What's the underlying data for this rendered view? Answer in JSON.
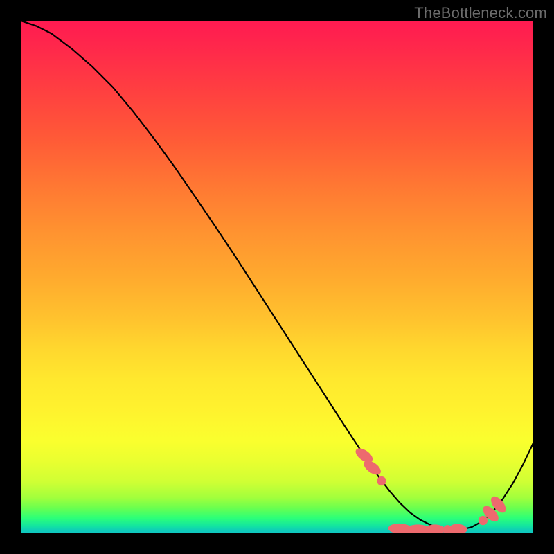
{
  "watermark": "TheBottleneck.com",
  "chart_data": {
    "type": "line",
    "title": "",
    "xlabel": "",
    "ylabel": "",
    "xlim": [
      0,
      100
    ],
    "ylim": [
      0,
      100
    ],
    "grid": false,
    "legend": false,
    "series": [
      {
        "name": "curve",
        "x": [
          0,
          3,
          6,
          10,
          14,
          18,
          22,
          26,
          30,
          34,
          38,
          42,
          46,
          50,
          54,
          58,
          62,
          65,
          68,
          70,
          72,
          74,
          76,
          78,
          80,
          82,
          84,
          86,
          88,
          90,
          92,
          94,
          96,
          98,
          100
        ],
        "y": [
          100,
          99,
          97.5,
          94.5,
          91,
          87,
          82.2,
          77,
          71.5,
          65.7,
          59.8,
          53.8,
          47.6,
          41.4,
          35.2,
          29,
          22.8,
          18.2,
          13.7,
          10.8,
          8.2,
          5.9,
          4.0,
          2.6,
          1.6,
          1.0,
          0.7,
          0.7,
          1.2,
          2.3,
          4.1,
          6.6,
          9.7,
          13.4,
          17.6
        ]
      }
    ],
    "markers": [
      {
        "name": "marker-lozenge",
        "cx": 67.0,
        "cy": 15.2,
        "rx": 1.0,
        "ry": 1.9,
        "rot": -55
      },
      {
        "name": "marker-lozenge",
        "cx": 68.6,
        "cy": 12.8,
        "rx": 1.0,
        "ry": 1.9,
        "rot": -55
      },
      {
        "name": "marker-dot",
        "cx": 70.4,
        "cy": 10.2,
        "rx": 0.9,
        "ry": 0.9,
        "rot": 0
      },
      {
        "name": "marker-lozenge",
        "cx": 74.0,
        "cy": 0.9,
        "rx": 1.0,
        "ry": 2.3,
        "rot": -88
      },
      {
        "name": "marker-lozenge",
        "cx": 77.5,
        "cy": 0.7,
        "rx": 1.0,
        "ry": 2.3,
        "rot": -90
      },
      {
        "name": "marker-lozenge",
        "cx": 80.8,
        "cy": 0.7,
        "rx": 1.0,
        "ry": 2.0,
        "rot": -90
      },
      {
        "name": "marker-dot",
        "cx": 83.3,
        "cy": 0.7,
        "rx": 0.9,
        "ry": 0.9,
        "rot": 0
      },
      {
        "name": "marker-lozenge",
        "cx": 85.3,
        "cy": 0.8,
        "rx": 1.0,
        "ry": 1.8,
        "rot": -87
      },
      {
        "name": "marker-dot",
        "cx": 90.2,
        "cy": 2.5,
        "rx": 0.9,
        "ry": 0.9,
        "rot": 0
      },
      {
        "name": "marker-lozenge",
        "cx": 91.7,
        "cy": 3.8,
        "rx": 1.0,
        "ry": 1.9,
        "rot": -45
      },
      {
        "name": "marker-lozenge",
        "cx": 93.2,
        "cy": 5.6,
        "rx": 1.0,
        "ry": 1.9,
        "rot": -40
      }
    ],
    "marker_color": "#ed6a6e",
    "curve_color": "#000000",
    "curve_width": 2.2
  }
}
